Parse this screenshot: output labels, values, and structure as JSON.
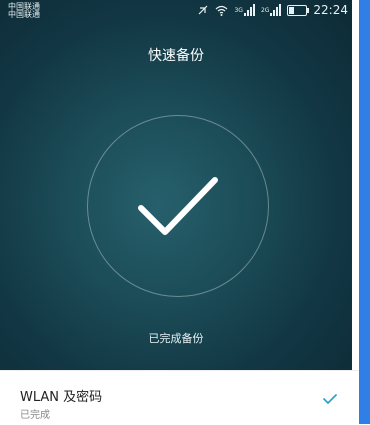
{
  "status_bar": {
    "carrier_1": "中国联通",
    "carrier_2": "中国联通",
    "net_1": "3G",
    "net_2": "2G",
    "time": "22:24"
  },
  "screen": {
    "title": "快速备份",
    "status_text": "已完成备份"
  },
  "list": [
    {
      "title": "WLAN 及密码",
      "subtitle": "已完成"
    }
  ],
  "colors": {
    "accent": "#2fa6c9",
    "hero_dark": "#0d2a35",
    "hero_light": "#26606c",
    "right_strip": "#2f7fe6"
  }
}
